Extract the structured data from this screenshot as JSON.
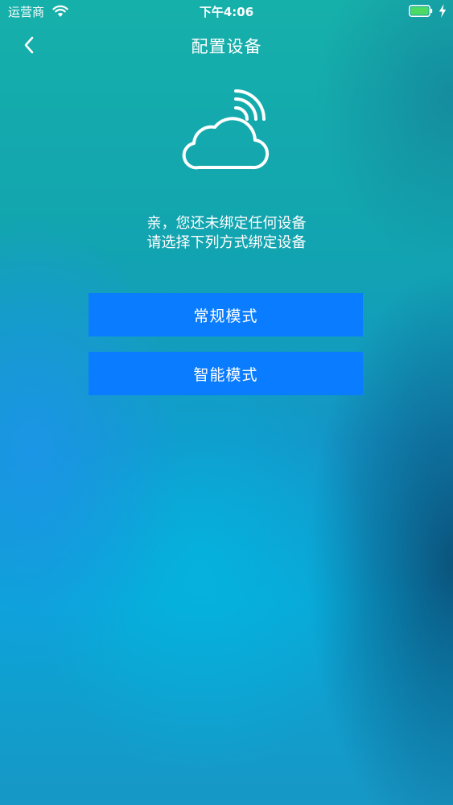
{
  "status_bar": {
    "carrier": "运营商",
    "time": "下午4:06",
    "icons": [
      "wifi-icon",
      "battery-icon",
      "charging-bolt-icon"
    ],
    "battery_color": "#4cd964"
  },
  "nav": {
    "back_icon": "chevron-left-icon",
    "title": "配置设备"
  },
  "illustration": {
    "icon": "cloud-wifi-icon"
  },
  "message": {
    "line1": "亲，您还未绑定任何设备",
    "line2": "请选择下列方式绑定设备"
  },
  "buttons": {
    "normal_mode": "常规模式",
    "smart_mode": "智能模式",
    "color": "#0a7cff"
  }
}
